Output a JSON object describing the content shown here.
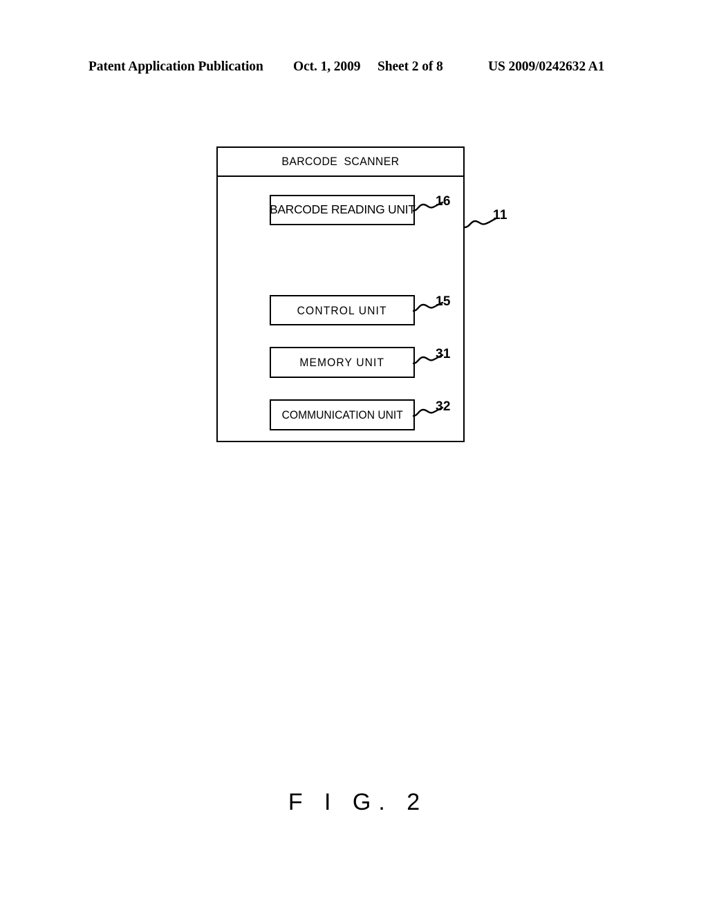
{
  "page_header": {
    "publication_label": "Patent Application Publication",
    "date": "Oct. 1, 2009",
    "sheet": "Sheet 2 of 8",
    "publication_number": "US 2009/0242632 A1"
  },
  "figure": {
    "caption": "F I G. 2",
    "device": {
      "title": "BARCODE SCANNER",
      "reference_numeral": "11"
    },
    "units": [
      {
        "label": "BARCODE READING UNIT",
        "reference_numeral": "16"
      },
      {
        "label": "CONTROL UNIT",
        "reference_numeral": "15"
      },
      {
        "label": "MEMORY UNIT",
        "reference_numeral": "31"
      },
      {
        "label": "COMMUNICATION UNIT",
        "reference_numeral": "32"
      }
    ]
  },
  "colors": {
    "ink": "#000000",
    "paper": "#ffffff"
  }
}
